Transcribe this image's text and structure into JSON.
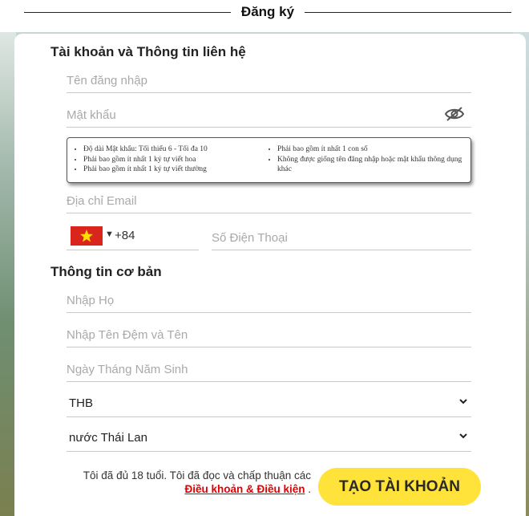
{
  "header": {
    "title": "Đăng ký"
  },
  "account_section": {
    "title": "Tài khoản và Thông tin liên hệ",
    "username_placeholder": "Tên đăng nhập",
    "password_placeholder": "Mật khẩu",
    "password_rules": {
      "col1": [
        "Độ dài Mật khẩu: Tối thiểu 6 - Tối đa 10",
        "Phải bao gồm ít nhất 1 ký tự viết hoa",
        "Phải bao gồm ít nhất 1 ký tự viết thường"
      ],
      "col2": [
        "Phải bao gồm ít nhất 1 con số",
        "Không được giống tên đăng nhập hoặc mật khẩu thông dụng khác"
      ]
    },
    "email_placeholder": "Địa chỉ Email",
    "phone_code": "+84",
    "phone_placeholder": "Số Điện Thoại"
  },
  "basic_section": {
    "title": "Thông tin cơ bản",
    "last_name_placeholder": "Nhập Họ",
    "first_name_placeholder": "Nhập Tên Đệm và Tên",
    "dob_placeholder": "Ngày Tháng Năm Sinh",
    "currency_value": "THB",
    "country_value": "nước Thái Lan"
  },
  "terms": {
    "text": "Tôi đã đủ 18 tuổi. Tôi đã đọc và chấp thuận các",
    "link_text": "Điều khoản & Điều kiện",
    "end": " ."
  },
  "submit": {
    "label": "TẠO TÀI KHOẢN"
  },
  "colors": {
    "button": "#ffe23a",
    "link": "#e00000",
    "flag_red": "#da251d",
    "flag_star": "#ffdd00"
  },
  "icons": {
    "password_toggle": "eye-slash-icon",
    "select_caret": "chevron-down-icon",
    "country_flag": "vietnam-flag-icon"
  }
}
